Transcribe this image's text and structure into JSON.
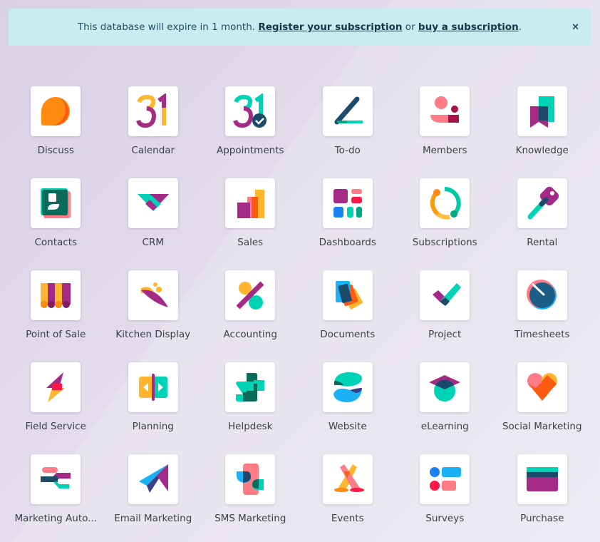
{
  "banner": {
    "text_before": "This database will expire in 1 month. ",
    "register_link": "Register your subscription",
    "text_middle": " or ",
    "buy_link": "buy a subscription",
    "text_after": ".",
    "close_label": "×"
  },
  "apps": [
    {
      "label": "Discuss",
      "icon": "discuss-icon"
    },
    {
      "label": "Calendar",
      "icon": "calendar-icon"
    },
    {
      "label": "Appointments",
      "icon": "appointments-icon"
    },
    {
      "label": "To-do",
      "icon": "todo-icon"
    },
    {
      "label": "Members",
      "icon": "members-icon"
    },
    {
      "label": "Knowledge",
      "icon": "knowledge-icon"
    },
    {
      "label": "Contacts",
      "icon": "contacts-icon"
    },
    {
      "label": "CRM",
      "icon": "crm-icon"
    },
    {
      "label": "Sales",
      "icon": "sales-icon"
    },
    {
      "label": "Dashboards",
      "icon": "dashboards-icon"
    },
    {
      "label": "Subscriptions",
      "icon": "subscriptions-icon"
    },
    {
      "label": "Rental",
      "icon": "rental-icon"
    },
    {
      "label": "Point of Sale",
      "icon": "point-of-sale-icon"
    },
    {
      "label": "Kitchen Display",
      "icon": "kitchen-display-icon"
    },
    {
      "label": "Accounting",
      "icon": "accounting-icon"
    },
    {
      "label": "Documents",
      "icon": "documents-icon"
    },
    {
      "label": "Project",
      "icon": "project-icon"
    },
    {
      "label": "Timesheets",
      "icon": "timesheets-icon"
    },
    {
      "label": "Field Service",
      "icon": "field-service-icon"
    },
    {
      "label": "Planning",
      "icon": "planning-icon"
    },
    {
      "label": "Helpdesk",
      "icon": "helpdesk-icon"
    },
    {
      "label": "Website",
      "icon": "website-icon"
    },
    {
      "label": "eLearning",
      "icon": "elearning-icon"
    },
    {
      "label": "Social Marketing",
      "icon": "social-marketing-icon"
    },
    {
      "label": "Marketing Auto...",
      "icon": "marketing-automation-icon"
    },
    {
      "label": "Email Marketing",
      "icon": "email-marketing-icon"
    },
    {
      "label": "SMS Marketing",
      "icon": "sms-marketing-icon"
    },
    {
      "label": "Events",
      "icon": "events-icon"
    },
    {
      "label": "Surveys",
      "icon": "surveys-icon"
    },
    {
      "label": "Purchase",
      "icon": "purchase-icon"
    }
  ]
}
